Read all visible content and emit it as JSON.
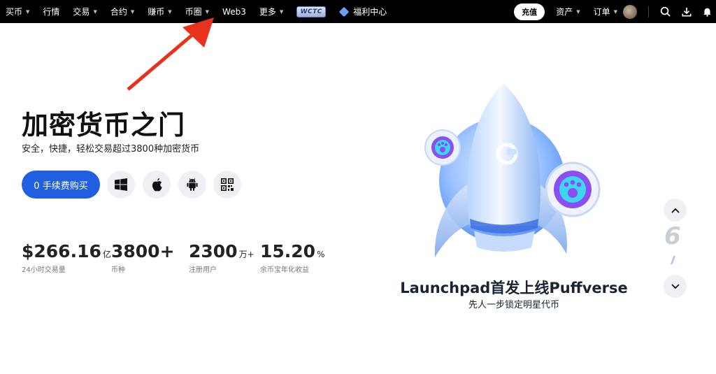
{
  "nav": {
    "items": [
      {
        "label": "买币",
        "caret": true
      },
      {
        "label": "行情",
        "caret": false
      },
      {
        "label": "交易",
        "caret": true
      },
      {
        "label": "合约",
        "caret": true
      },
      {
        "label": "赚币",
        "caret": true
      },
      {
        "label": "币圈",
        "caret": true
      },
      {
        "label": "Web3",
        "caret": false
      },
      {
        "label": "更多",
        "caret": true
      }
    ],
    "wctc_label": "WCTC",
    "welfare_label": "福利中心",
    "deposit_label": "充值",
    "assets_label": "资产",
    "orders_label": "订单"
  },
  "hero": {
    "title": "加密货币之门",
    "subtitle": "安全，快捷，轻松交易超过3800种加密货币",
    "buy_button": "0 手续费购买"
  },
  "stats": [
    {
      "value": "$266.16",
      "unit": "亿",
      "label": "24小时交易量"
    },
    {
      "value": "3800+",
      "unit": "",
      "label": "币种"
    },
    {
      "value": "2300",
      "unit": "万+",
      "label": "注册用户"
    },
    {
      "value": "15.20",
      "unit": "%",
      "label": "余币宝年化收益"
    }
  ],
  "banner": {
    "title": "Launchpad首发上线Puffverse",
    "subtitle": "先人一步锁定明星代币"
  },
  "pager": {
    "current": "6"
  },
  "colors": {
    "accent": "#1f5fe0",
    "topbar": "#000000",
    "arrow": "#e8321e"
  }
}
